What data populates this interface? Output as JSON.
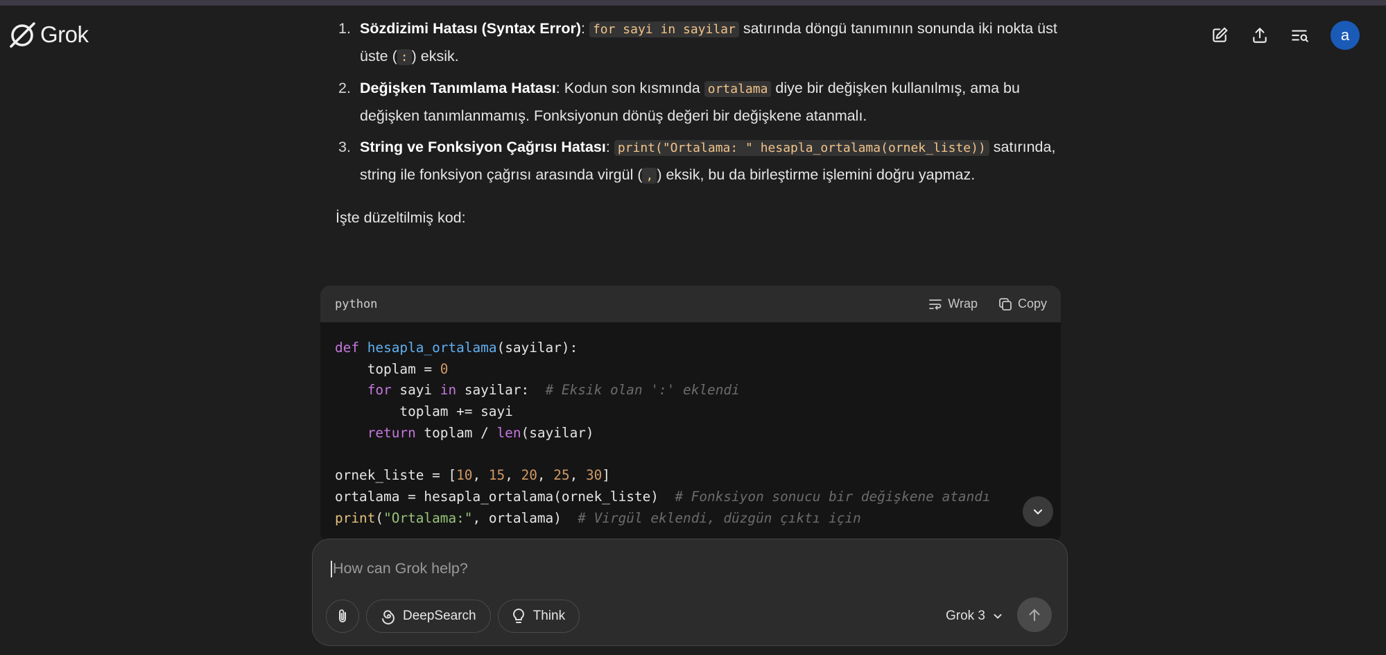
{
  "app": {
    "logo_text": "Grok",
    "avatar_letter": "a"
  },
  "answer": {
    "items": [
      {
        "num": "1.",
        "title": "Sözdizimi Hatası (Syntax Error)",
        "code1": "for sayi in sayilar",
        "text1": " satırında döngü tanımının sonunda iki nokta üst üste (",
        "code2": ":",
        "text2": ") eksik."
      },
      {
        "num": "2.",
        "title": "Değişken Tanımlama Hatası",
        "text1": ": Kodun son kısmında ",
        "code1": "ortalama",
        "text2": " diye bir değişken kullanılmış, ama bu değişken tanımlanmamış. Fonksiyonun dönüş değeri bir değişkene atanmalı."
      },
      {
        "num": "3.",
        "title": "String ve Fonksiyon Çağrısı Hatası",
        "code1": "print(\"Ortalama: \" hesapla_ortalama(ornek_liste))",
        "text1": " satırında, string ile fonksiyon çağrısı arasında virgül (",
        "code2": ",",
        "text2": ") eksik, bu da birleştirme işlemini doğru yapmaz."
      }
    ],
    "fixed_intro": "İşte düzeltilmiş kod:"
  },
  "codeblock": {
    "language": "python",
    "wrap_label": "Wrap",
    "copy_label": "Copy",
    "tokens": {
      "def": "def",
      "fname": "hesapla_ortalama",
      "l1_rest": "(sayilar):",
      "l2a": "    toplam = ",
      "zero": "0",
      "indent": "    ",
      "for": "for",
      "l3_mid": " sayi ",
      "in": "in",
      "l3_rest": " sayilar:  ",
      "c1": "# Eksik olan ':' eklendi",
      "l4": "        toplam += sayi",
      "return": "return",
      "l5_mid": " toplam / ",
      "len": "len",
      "l5_rest": "(sayilar)",
      "l7a": "ornek_liste = [",
      "n10": "10",
      "n15": "15",
      "n20": "20",
      "n25": "25",
      "n30": "30",
      "sep": ", ",
      "l7z": "]",
      "l8": "ortalama = hesapla_ortalama(ornek_liste)  ",
      "c2": "# Fonksiyon sonucu bir değişkene atandı",
      "print": "print",
      "paren": "(",
      "str": "\"Ortalama:\"",
      "l9_rest": ", ortalama)  ",
      "c3": "# Virgül eklendi, düzgün çıktı için"
    }
  },
  "composer": {
    "placeholder": "How can Grok help?",
    "deepsearch_label": "DeepSearch",
    "think_label": "Think",
    "model_label": "Grok 3"
  }
}
